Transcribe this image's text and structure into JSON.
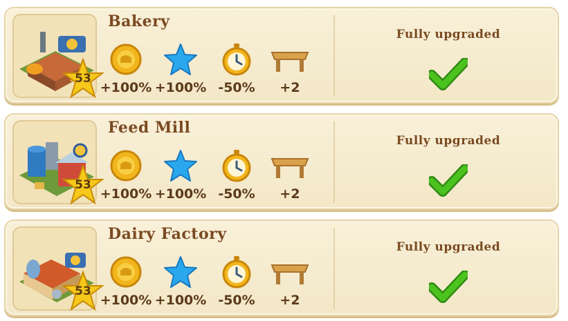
{
  "buildings": [
    {
      "name": "Bakery",
      "level": "53",
      "bonuses": [
        "+100%",
        "+100%",
        "-50%",
        "+2"
      ],
      "status": "Fully upgraded"
    },
    {
      "name": "Feed Mill",
      "level": "53",
      "bonuses": [
        "+100%",
        "+100%",
        "-50%",
        "+2"
      ],
      "status": "Fully upgraded"
    },
    {
      "name": "Dairy Factory",
      "level": "53",
      "bonuses": [
        "+100%",
        "+100%",
        "-50%",
        "+2"
      ],
      "status": "Fully upgraded"
    }
  ],
  "bonus_icons": [
    "coin-icon",
    "star-icon",
    "stopwatch-icon",
    "table-slot-icon"
  ],
  "colors": {
    "panel": "#f5ecd0",
    "title": "#7a4a22",
    "check": "#4cc21f",
    "coin": "#f2b51c",
    "star": "#2aa8ee"
  }
}
